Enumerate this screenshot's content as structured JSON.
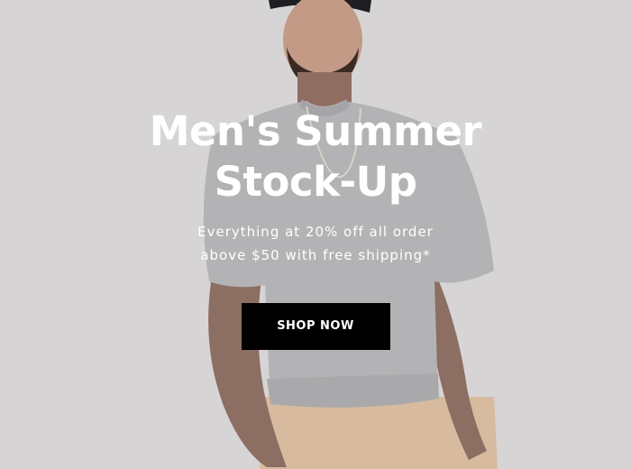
{
  "hero": {
    "title_line1": "Men's Summer",
    "title_line2": "Stock-Up",
    "subtitle_line1": "Everything at 20% off all order",
    "subtitle_line2": "above $50 with free shipping*",
    "cta_label": "SHOP NOW"
  },
  "colors": {
    "background": "#d6d3d4",
    "button": "#000000",
    "text": "#ffffff"
  }
}
